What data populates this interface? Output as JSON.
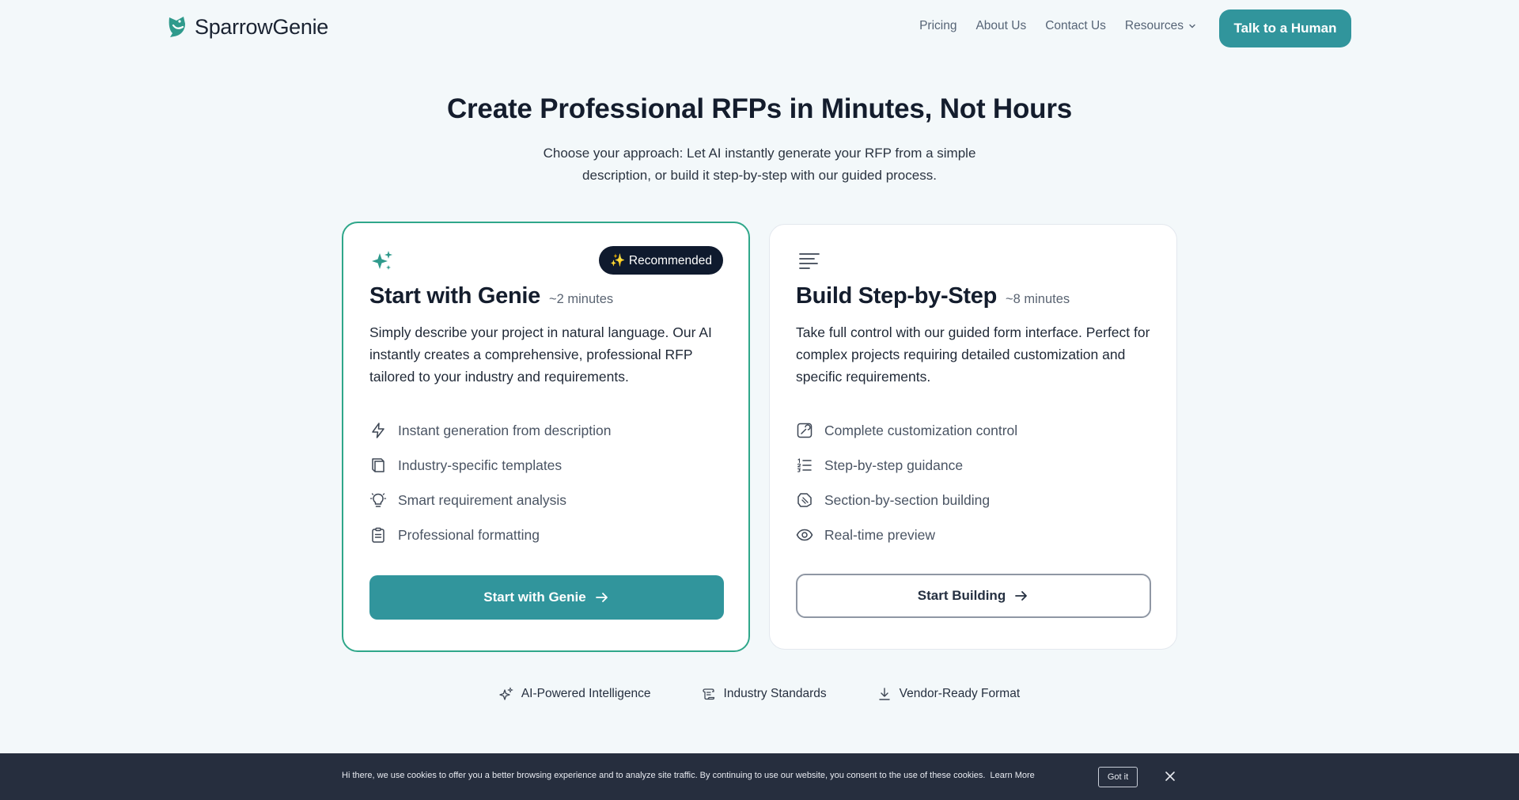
{
  "brand": {
    "name": "SparrowGenie",
    "color": "#31959c"
  },
  "nav": {
    "links": [
      "Pricing",
      "About Us",
      "Contact Us"
    ],
    "resources": "Resources",
    "cta": "Talk to a Human"
  },
  "hero": {
    "title": "Create Professional RFPs in Minutes, Not Hours",
    "subtitle": "Choose your approach: Let AI instantly generate your RFP from a simple description, or build it step-by-step with our guided process."
  },
  "genie_card": {
    "badge": "✨ Recommended",
    "title": "Start with Genie",
    "time": "~2 minutes",
    "description": "Simply describe your project in natural language. Our AI instantly creates a comprehensive, professional RFP tailored to your industry and requirements.",
    "features": [
      {
        "label": "Instant generation from description",
        "icon": "lightning-icon"
      },
      {
        "label": "Industry-specific templates",
        "icon": "book-icon"
      },
      {
        "label": "Smart requirement analysis",
        "icon": "lightbulb-icon"
      },
      {
        "label": "Professional formatting",
        "icon": "clipboard-icon"
      }
    ],
    "button": "Start with Genie"
  },
  "build_card": {
    "title": "Build Step-by-Step",
    "time": "~8 minutes",
    "description": "Take full control with our guided form interface. Perfect for complex projects requiring detailed customization and specific requirements.",
    "features": [
      {
        "label": "Complete customization control",
        "icon": "customize-icon"
      },
      {
        "label": "Step-by-step guidance",
        "icon": "numbered-list-icon"
      },
      {
        "label": "Section-by-section building",
        "icon": "sections-icon"
      },
      {
        "label": "Real-time preview",
        "icon": "eye-icon"
      }
    ],
    "button": "Start Building"
  },
  "highlights": [
    "AI-Powered Intelligence",
    "Industry Standards",
    "Vendor-Ready Format"
  ],
  "cookie": {
    "text": "Hi there, we use cookies to offer you a better browsing experience and to analyze site traffic. By continuing to use our website, you consent to the use of these cookies.",
    "link": "Learn More",
    "button": "Got it"
  }
}
